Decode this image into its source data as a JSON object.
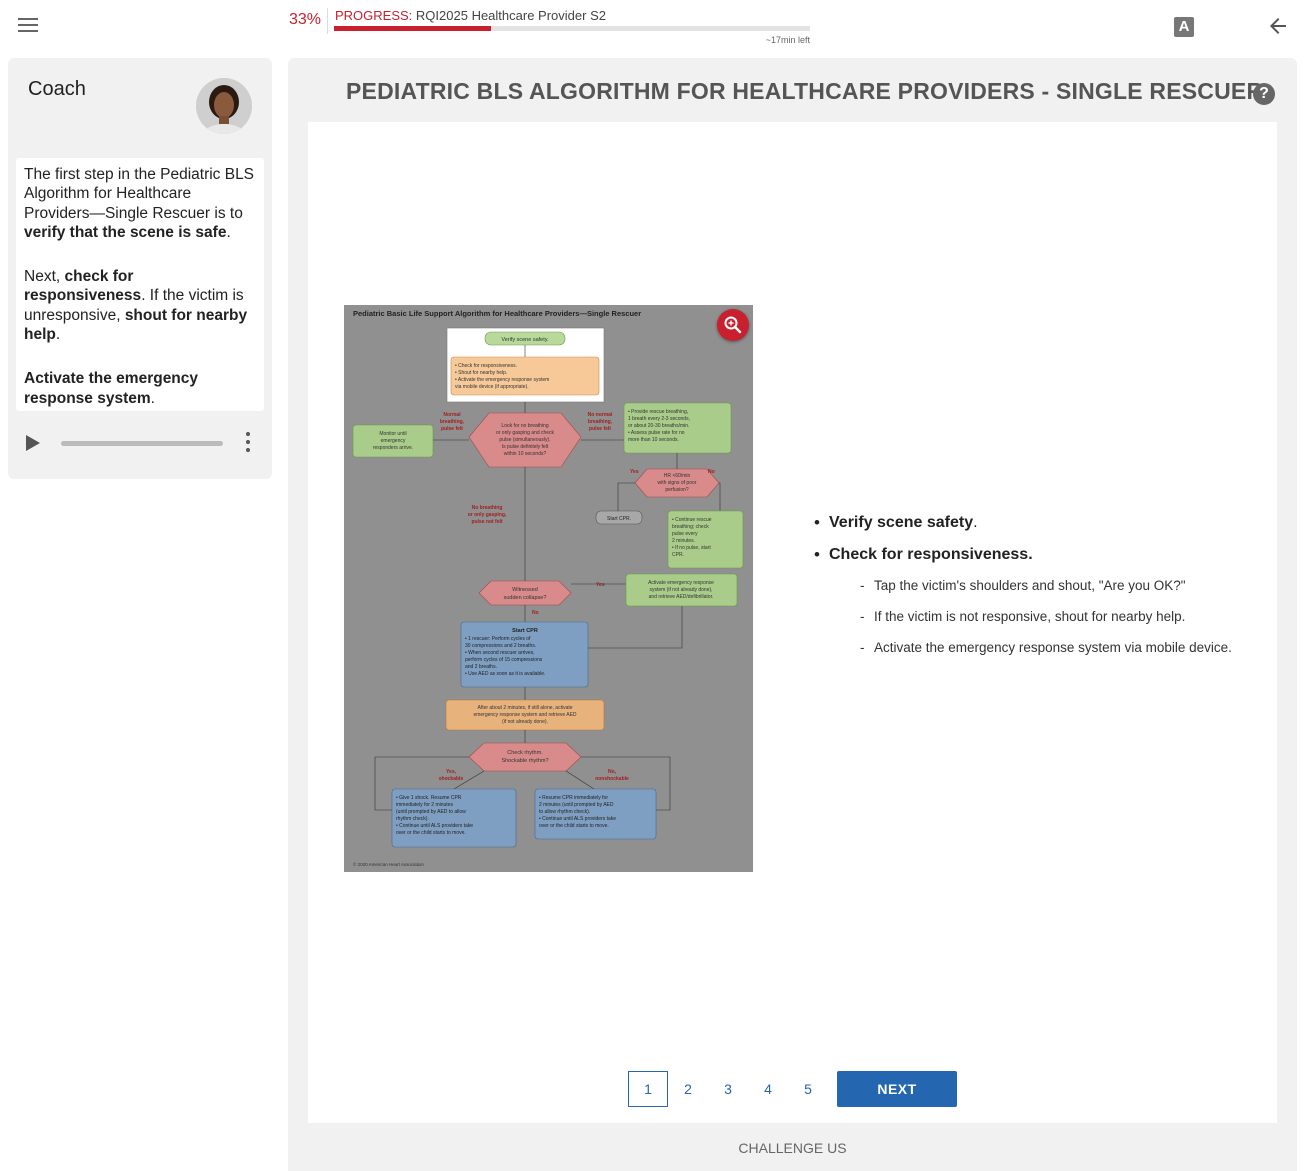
{
  "header": {
    "progress_percent": "33%",
    "progress_fraction": 0.33,
    "progress_label": "PROGRESS:",
    "course_name": "RQI2025 Healthcare Provider S2",
    "time_left": "~17min left",
    "a_icon_letter": "A"
  },
  "coach": {
    "title": "Coach",
    "paragraphs": [
      {
        "pre": "The first step in the Pediatric BLS Algorithm for Healthcare Providers—Single Rescuer is to ",
        "bold": "verify that the scene is safe",
        "post": "."
      },
      {
        "pre": "Next, ",
        "bold": "check for responsiveness",
        "post": ". If the victim is unresponsive, ",
        "bold2": "shout for nearby help",
        "post2": "."
      },
      {
        "pre": "",
        "bold": "Activate the emergency response system",
        "post": "."
      }
    ]
  },
  "main": {
    "title": "PEDIATRIC BLS ALGORITHM FOR HEALTHCARE PROVIDERS - SINGLE RESCUER",
    "help_symbol": "?",
    "figure": {
      "title": "Pediatric Basic Life Support Algorithm for Healthcare Providers—Single Rescuer",
      "verify": "Verify scene safety.",
      "check1": "• Check for responsiveness.",
      "check2": "• Shout for nearby help.",
      "check3": "• Activate the emergency response system",
      "check4": "  via mobile device (if appropriate).",
      "normal1": "Normal",
      "normal2": "breathing,",
      "normal3": "pulse felt",
      "nonormal1": "No normal",
      "nonormal2": "breathing,",
      "nonormal3": "pulse felt",
      "monitor1": "Monitor until",
      "monitor2": "emergency",
      "monitor3": "responders arrive.",
      "look1": "Look for no breathing",
      "look2": "or only gasping and check",
      "look3": "pulse (simultaneously).",
      "look4": "Is pulse definitely felt",
      "look5": "within 10 seconds?",
      "rescue1": "• Provide rescue breathing,",
      "rescue2": "  1 breath every 2-3 seconds,",
      "rescue3": "  or about 20-30 breaths/min.",
      "rescue4": "• Assess pulse rate for no",
      "rescue5": "  more than 10 seconds.",
      "yes": "Yes",
      "no": "No",
      "hr1": "HR <60/min",
      "hr2": "with signs of poor",
      "hr3": "perfusion?",
      "startcpr_small": "Start CPR.",
      "cont1": "• Continue rescue",
      "cont2": "  breathing; check",
      "cont3": "  pulse every",
      "cont4": "  2 minutes.",
      "cont5": "• If no pulse, start",
      "cont6": "  CPR.",
      "nobreath1": "No breathing",
      "nobreath2": "or only gasping,",
      "nobreath3": "pulse not felt",
      "witnessed1": "Witnessed",
      "witnessed2": "sudden collapse?",
      "activate1": "Activate emergency response",
      "activate2": "system (if not already done),",
      "activate3": "and retrieve AED/defibrillator.",
      "cpr_title": "Start CPR",
      "cpr1": "• 1 rescuer: Perform cycles of",
      "cpr2": "  30 compressions and 2 breaths.",
      "cpr3": "• When second rescuer arrives,",
      "cpr4": "  perform cycles of 15 compressions",
      "cpr5": "  and 2 breaths.",
      "cpr6": "• Use AED as soon as it is available.",
      "after1": "After about 2 minutes, if still alone, activate",
      "after2": "emergency response system and retrieve AED",
      "after3": "(if not already done).",
      "rhythm1": "Check rhythm.",
      "rhythm2": "Shockable rhythm?",
      "yesshock1": "Yes,",
      "yesshock2": "shockable",
      "noshock1": "No,",
      "noshock2": "nonshockable",
      "shock1": "• Give 1 shock. Resume CPR",
      "shock2": "  immediately for 2 minutes",
      "shock3": "  (until prompted by AED to allow",
      "shock4": "  rhythm check).",
      "shock5": "• Continue until ALS providers take",
      "shock6": "  over or the child starts to move.",
      "resume1": "• Resume CPR immediately for",
      "resume2": "  2 minutes (until prompted by AED",
      "resume3": "  to allow rhythm check).",
      "resume4": "• Continue until ALS providers take",
      "resume5": "  over or the child starts to move.",
      "copyright": "© 2020 American Heart Association"
    },
    "bullets": [
      {
        "bold": "Verify scene safety",
        "post": "."
      },
      {
        "bold": "Check for responsiveness.",
        "post": ""
      }
    ],
    "sub_bullets": [
      "Tap the victim's shoulders and shout, \"Are you OK?\"",
      "If the victim is not responsive, shout for nearby help.",
      "Activate the emergency response system via mobile device."
    ],
    "pages": [
      "1",
      "2",
      "3",
      "4",
      "5"
    ],
    "next_label": "NEXT",
    "challenge_label": "CHALLENGE US"
  }
}
